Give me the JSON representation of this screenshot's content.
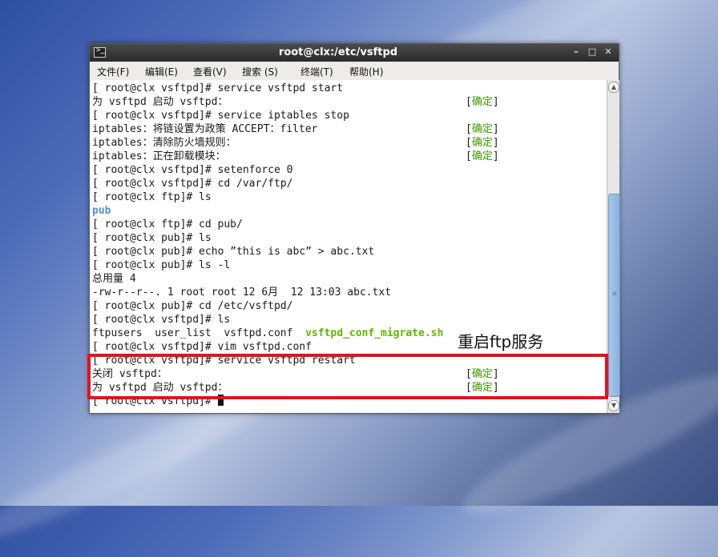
{
  "window": {
    "title": "root@clx:/etc/vsftpd",
    "minimize_glyph": "–",
    "maximize_glyph": "□",
    "close_glyph": "✕"
  },
  "menu": [
    "文件(F)",
    "编辑(E)",
    "查看(V)",
    "搜索 (S)",
    "终端(T)",
    "帮助(H)"
  ],
  "terminal": {
    "lines": [
      "[ root@clx vsftpd]# service vsftpd start",
      "为 vsftpd 启动 vsftpd：",
      "[ root@clx vsftpd]# service iptables stop",
      "iptables：将链设置为政策 ACCEPT：filter",
      "iptables：清除防火墙规则：",
      "iptables：正在卸载模块：",
      "[ root@clx vsftpd]# setenforce 0",
      "[ root@clx vsftpd]# cd /var/ftp/",
      "[ root@clx ftp]# ls",
      "pub",
      "[ root@clx ftp]# cd pub/",
      "[ root@clx pub]# ls",
      "[ root@clx pub]# echo ”this is abc” > abc.txt",
      "[ root@clx pub]# ls -l",
      "总用量 4",
      "-rw-r--r--. 1 root root 12 6月  12 13:03 abc.txt",
      "[ root@clx pub]# cd /etc/vsftpd/",
      "[ root@clx vsftpd]# ls",
      "ftpusers  user_list  vsftpd.conf  ",
      "[ root@clx vsftpd]# vim vsftpd.conf",
      "[ root@clx vsftpd]# service vsftpd restart",
      "关闭 vsftpd：",
      "为 vsftpd 启动 vsftpd：",
      "[ root@clx vsftpd]# "
    ],
    "ls_executable": "vsftpd_conf_migrate.sh",
    "ok_left": "[",
    "ok_word": "确定",
    "ok_right": "]"
  },
  "annotation": {
    "text": "重启ftp服务",
    "box_color": "#e8101c"
  },
  "colors": {
    "ok_green": "#3c9a00",
    "dir_blue": "#5a8fc8",
    "exec_green": "#5fb800",
    "scroll_thumb": "#8bb0df"
  }
}
